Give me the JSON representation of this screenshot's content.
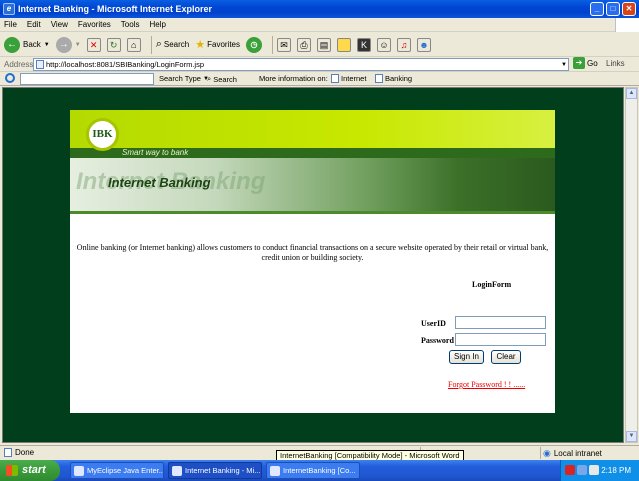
{
  "window": {
    "title": "Internet Banking - Microsoft Internet Explorer",
    "controls": {
      "minimize": "_",
      "maximize": "□",
      "close": "✕"
    }
  },
  "menu": [
    "File",
    "Edit",
    "View",
    "Favorites",
    "Tools",
    "Help"
  ],
  "toolbar": {
    "back": "Back",
    "search": "Search",
    "favorites": "Favorites"
  },
  "address": {
    "label": "Address",
    "url": "http://localhost:8081/SBIBanking/LoginForm.jsp",
    "go": "Go",
    "links": "Links"
  },
  "searchbar": {
    "search_type": "Search Type",
    "search": "Search",
    "more_info": "More information on:",
    "link1": "Internet",
    "link2": "Banking"
  },
  "page": {
    "logo_text": "IBK",
    "tagline": "Smart way to bank",
    "banner_title": "Internet Banking",
    "banner_ghost": "Internet Banking",
    "description": "Online banking (or Internet banking) allows customers to conduct financial transactions on a secure website operated by their retail or virtual bank, credit union or building society.",
    "form_title": "LoginForm",
    "userid_label": "UserID",
    "password_label": "Password",
    "signin": "Sign In",
    "clear": "Clear",
    "forgot": "Forgot Password ! ! ......"
  },
  "status": {
    "text": "Done",
    "zone": "Local intranet",
    "tooltip": "InternetBanking [Compatibility Mode] - Microsoft Word"
  },
  "taskbar": {
    "start": "start",
    "tasks": [
      "MyEclipse Java Enter...",
      "Internet Banking - Mi...",
      "InternetBanking [Co..."
    ],
    "clock": "2:18 PM"
  }
}
